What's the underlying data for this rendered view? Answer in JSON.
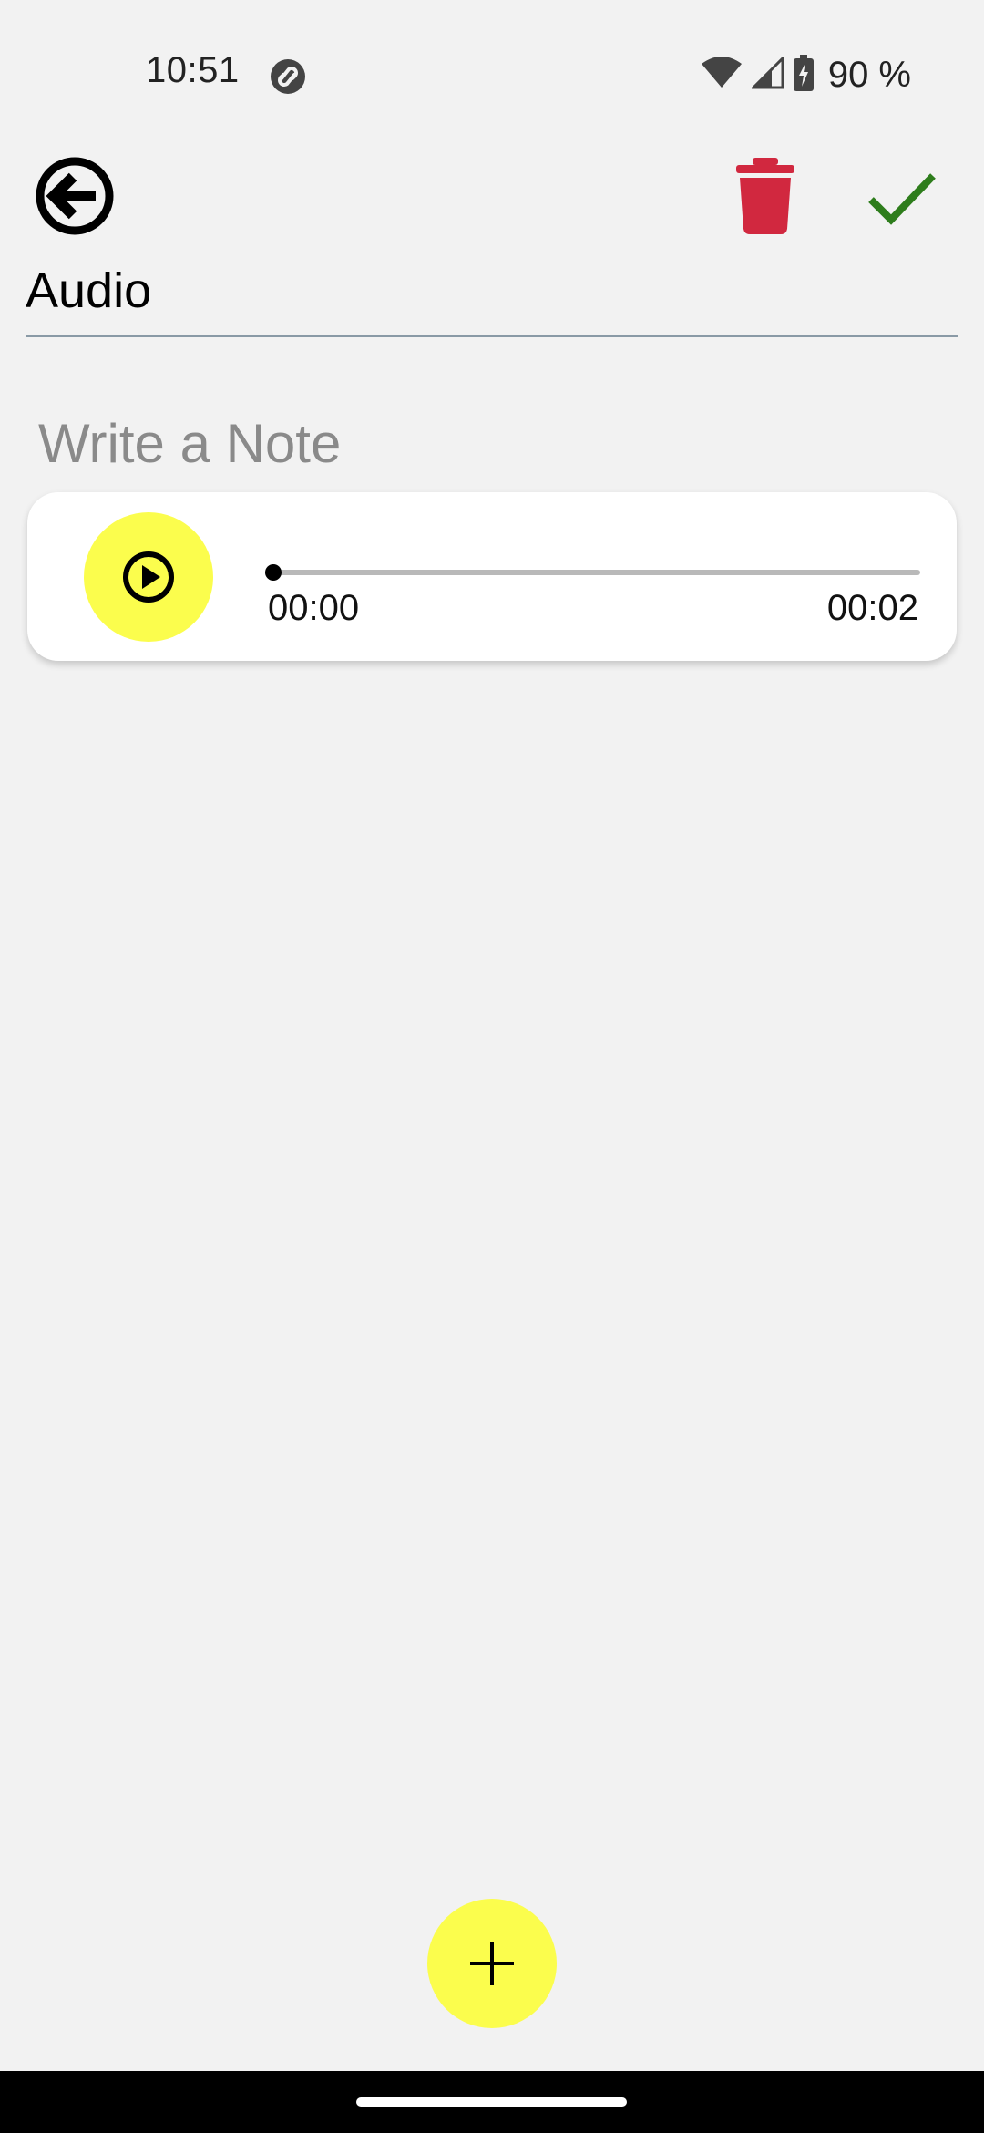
{
  "status_bar": {
    "time": "10:51",
    "battery_percent": "90 %",
    "icons": [
      "notification-app-icon",
      "wifi-icon",
      "cell-signal-icon",
      "battery-charging-icon"
    ]
  },
  "toolbar": {
    "back_icon": "back-arrow-circle-icon",
    "delete_icon": "trash-icon",
    "confirm_icon": "check-icon",
    "colors": {
      "delete": "#d1283f",
      "confirm": "#2e7d1c"
    }
  },
  "title_field": {
    "value": "Audio"
  },
  "note_field": {
    "placeholder": "Write a Note",
    "value": ""
  },
  "audio_player": {
    "play_icon": "play-circle-icon",
    "current_time": "00:00",
    "total_time": "00:02",
    "progress": 0,
    "accent_color": "#fbfd4d"
  },
  "fab": {
    "icon": "plus-icon",
    "color": "#fbfd4d"
  }
}
